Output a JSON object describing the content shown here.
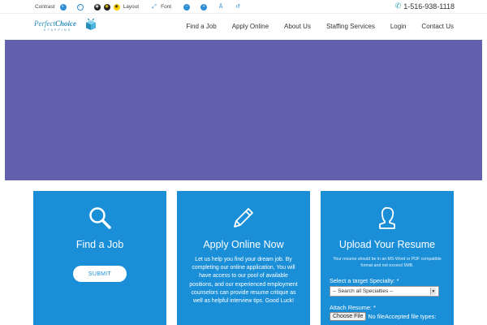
{
  "topbar": {
    "contrast_label": "Contrast",
    "layout_label": "Layout",
    "font_label": "Font",
    "phone": "1-516-938-1118"
  },
  "logo": {
    "name_part1": "Perfect",
    "name_part2": "Choice",
    "sub": "STAFFING"
  },
  "nav": {
    "items": [
      "Find a Job",
      "Apply Online",
      "About Us",
      "Staffing Services",
      "Login",
      "Contact Us"
    ]
  },
  "colors": {
    "hero": "#6360ad",
    "card": "#1a8fd8",
    "accent_teal": "#2aa4b4"
  },
  "cards": {
    "find": {
      "title": "Find a Job",
      "button": "SUBMIT",
      "icon": "search-icon"
    },
    "apply": {
      "title": "Apply Online Now",
      "icon": "pencil-icon",
      "description": "Let us help you find your dream job. By completing our online application, You will have access to our pool of available positions, and our experienced employment counselors can provide resume critique as well as helpful interview tips. Good Luck!"
    },
    "upload": {
      "title": "Upload Your Resume",
      "icon": "person-icon",
      "note": "Your resume should be in an MS-Word or PDF compatible format and not exceed 5MB.",
      "specialty_label": "Select a target Specialty:  *",
      "specialty_selected": "-- Search all Specialties --",
      "attach_label": "Attach Resume:  *",
      "choose_file": "Choose File",
      "no_file": "No fileAccepted file types:"
    }
  }
}
